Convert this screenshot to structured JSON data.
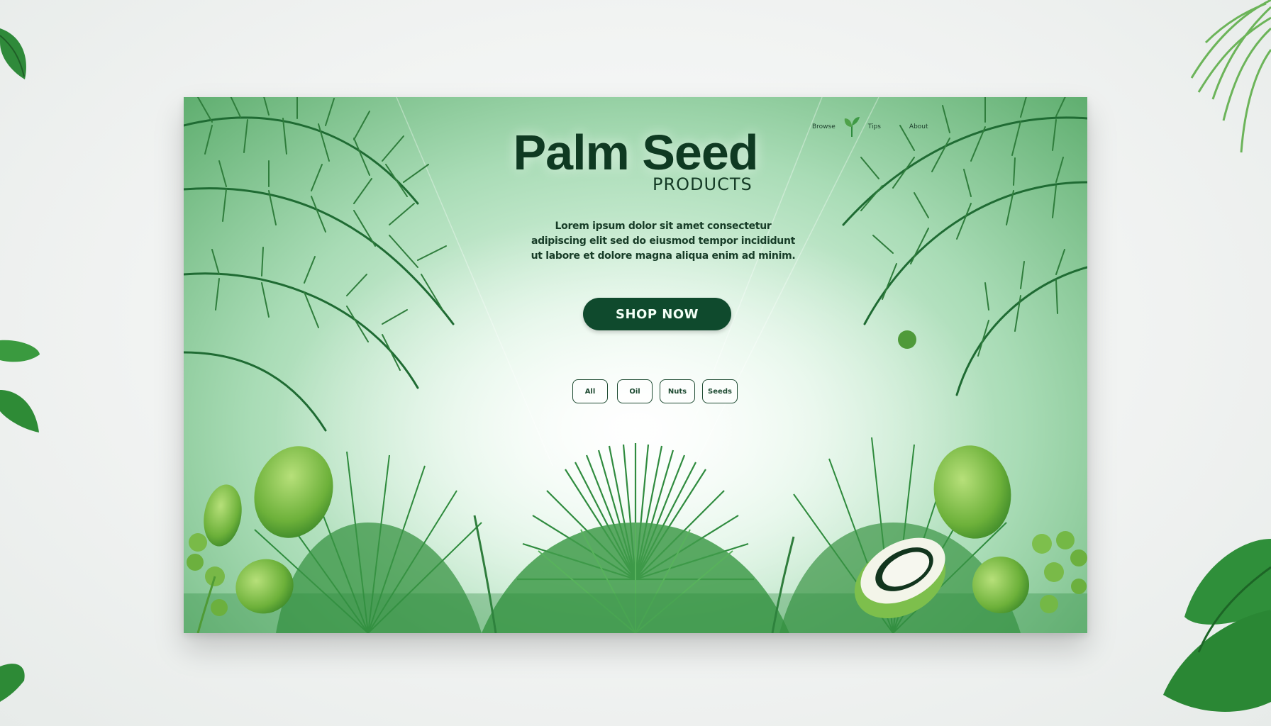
{
  "banner": {
    "title": "Palm Seed",
    "subtitle": "PRODUCTS",
    "description": "Lorem ipsum dolor sit amet consectetur adipiscing elit sed do eiusmod tempor incididunt ut labore et dolore magna aliqua enim ad minim.",
    "cta_label": "SHOP NOW",
    "top_links": [
      "Browse",
      "Tips",
      "About"
    ],
    "chips": [
      "All",
      "Oil",
      "Nuts",
      "Seeds"
    ]
  },
  "colors": {
    "accent": "#0f4a2d",
    "leaf_dark": "#1f6b33",
    "leaf_mid": "#3f9a45",
    "leaf_light": "#7bbf57",
    "seed": "#8cc63f"
  },
  "icons": [
    "palm-leaf-icon",
    "palm-seed-icon",
    "sprout-icon",
    "monstera-leaf-icon"
  ]
}
